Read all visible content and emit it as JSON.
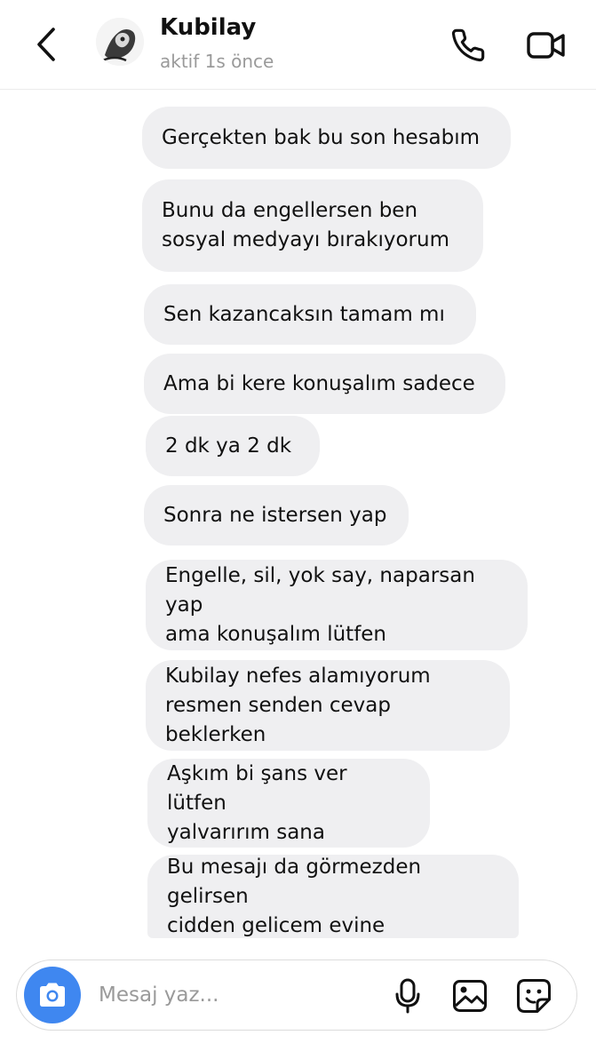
{
  "header": {
    "contact_name": "Kubilay",
    "status": "aktif 1s önce",
    "icons": {
      "back": "chevron-left-icon",
      "call": "phone-icon",
      "video": "video-camera-icon"
    }
  },
  "messages": [
    {
      "text": "Gerçekten bak bu son hesabım"
    },
    {
      "text": "Bunu da engellersen ben\nsosyal medyayı bırakıyorum"
    },
    {
      "text": "Sen kazancaksın tamam mı"
    },
    {
      "text": "Ama bi kere konuşalım sadece"
    },
    {
      "text": "2 dk ya 2 dk"
    },
    {
      "text": "Sonra ne istersen yap"
    },
    {
      "text": "Engelle, sil, yok say, naparsan yap\nama konuşalım lütfen"
    },
    {
      "text": "Kubilay nefes alamıyorum\nresmen senden cevap beklerken"
    },
    {
      "text": "Aşkım bi şans ver lütfen\nyalvarırım sana"
    },
    {
      "text": "Bu mesajı da görmezden gelirsen\ncidden gelicem evine"
    }
  ],
  "composer": {
    "placeholder": "Mesaj yaz...",
    "icons": {
      "camera": "camera-icon",
      "mic": "microphone-icon",
      "gallery": "image-icon",
      "sticker": "sticker-icon"
    }
  },
  "colors": {
    "bubble": "#efeff1",
    "camera_button": "#3f87f0",
    "status_text": "#9a9a9a"
  }
}
